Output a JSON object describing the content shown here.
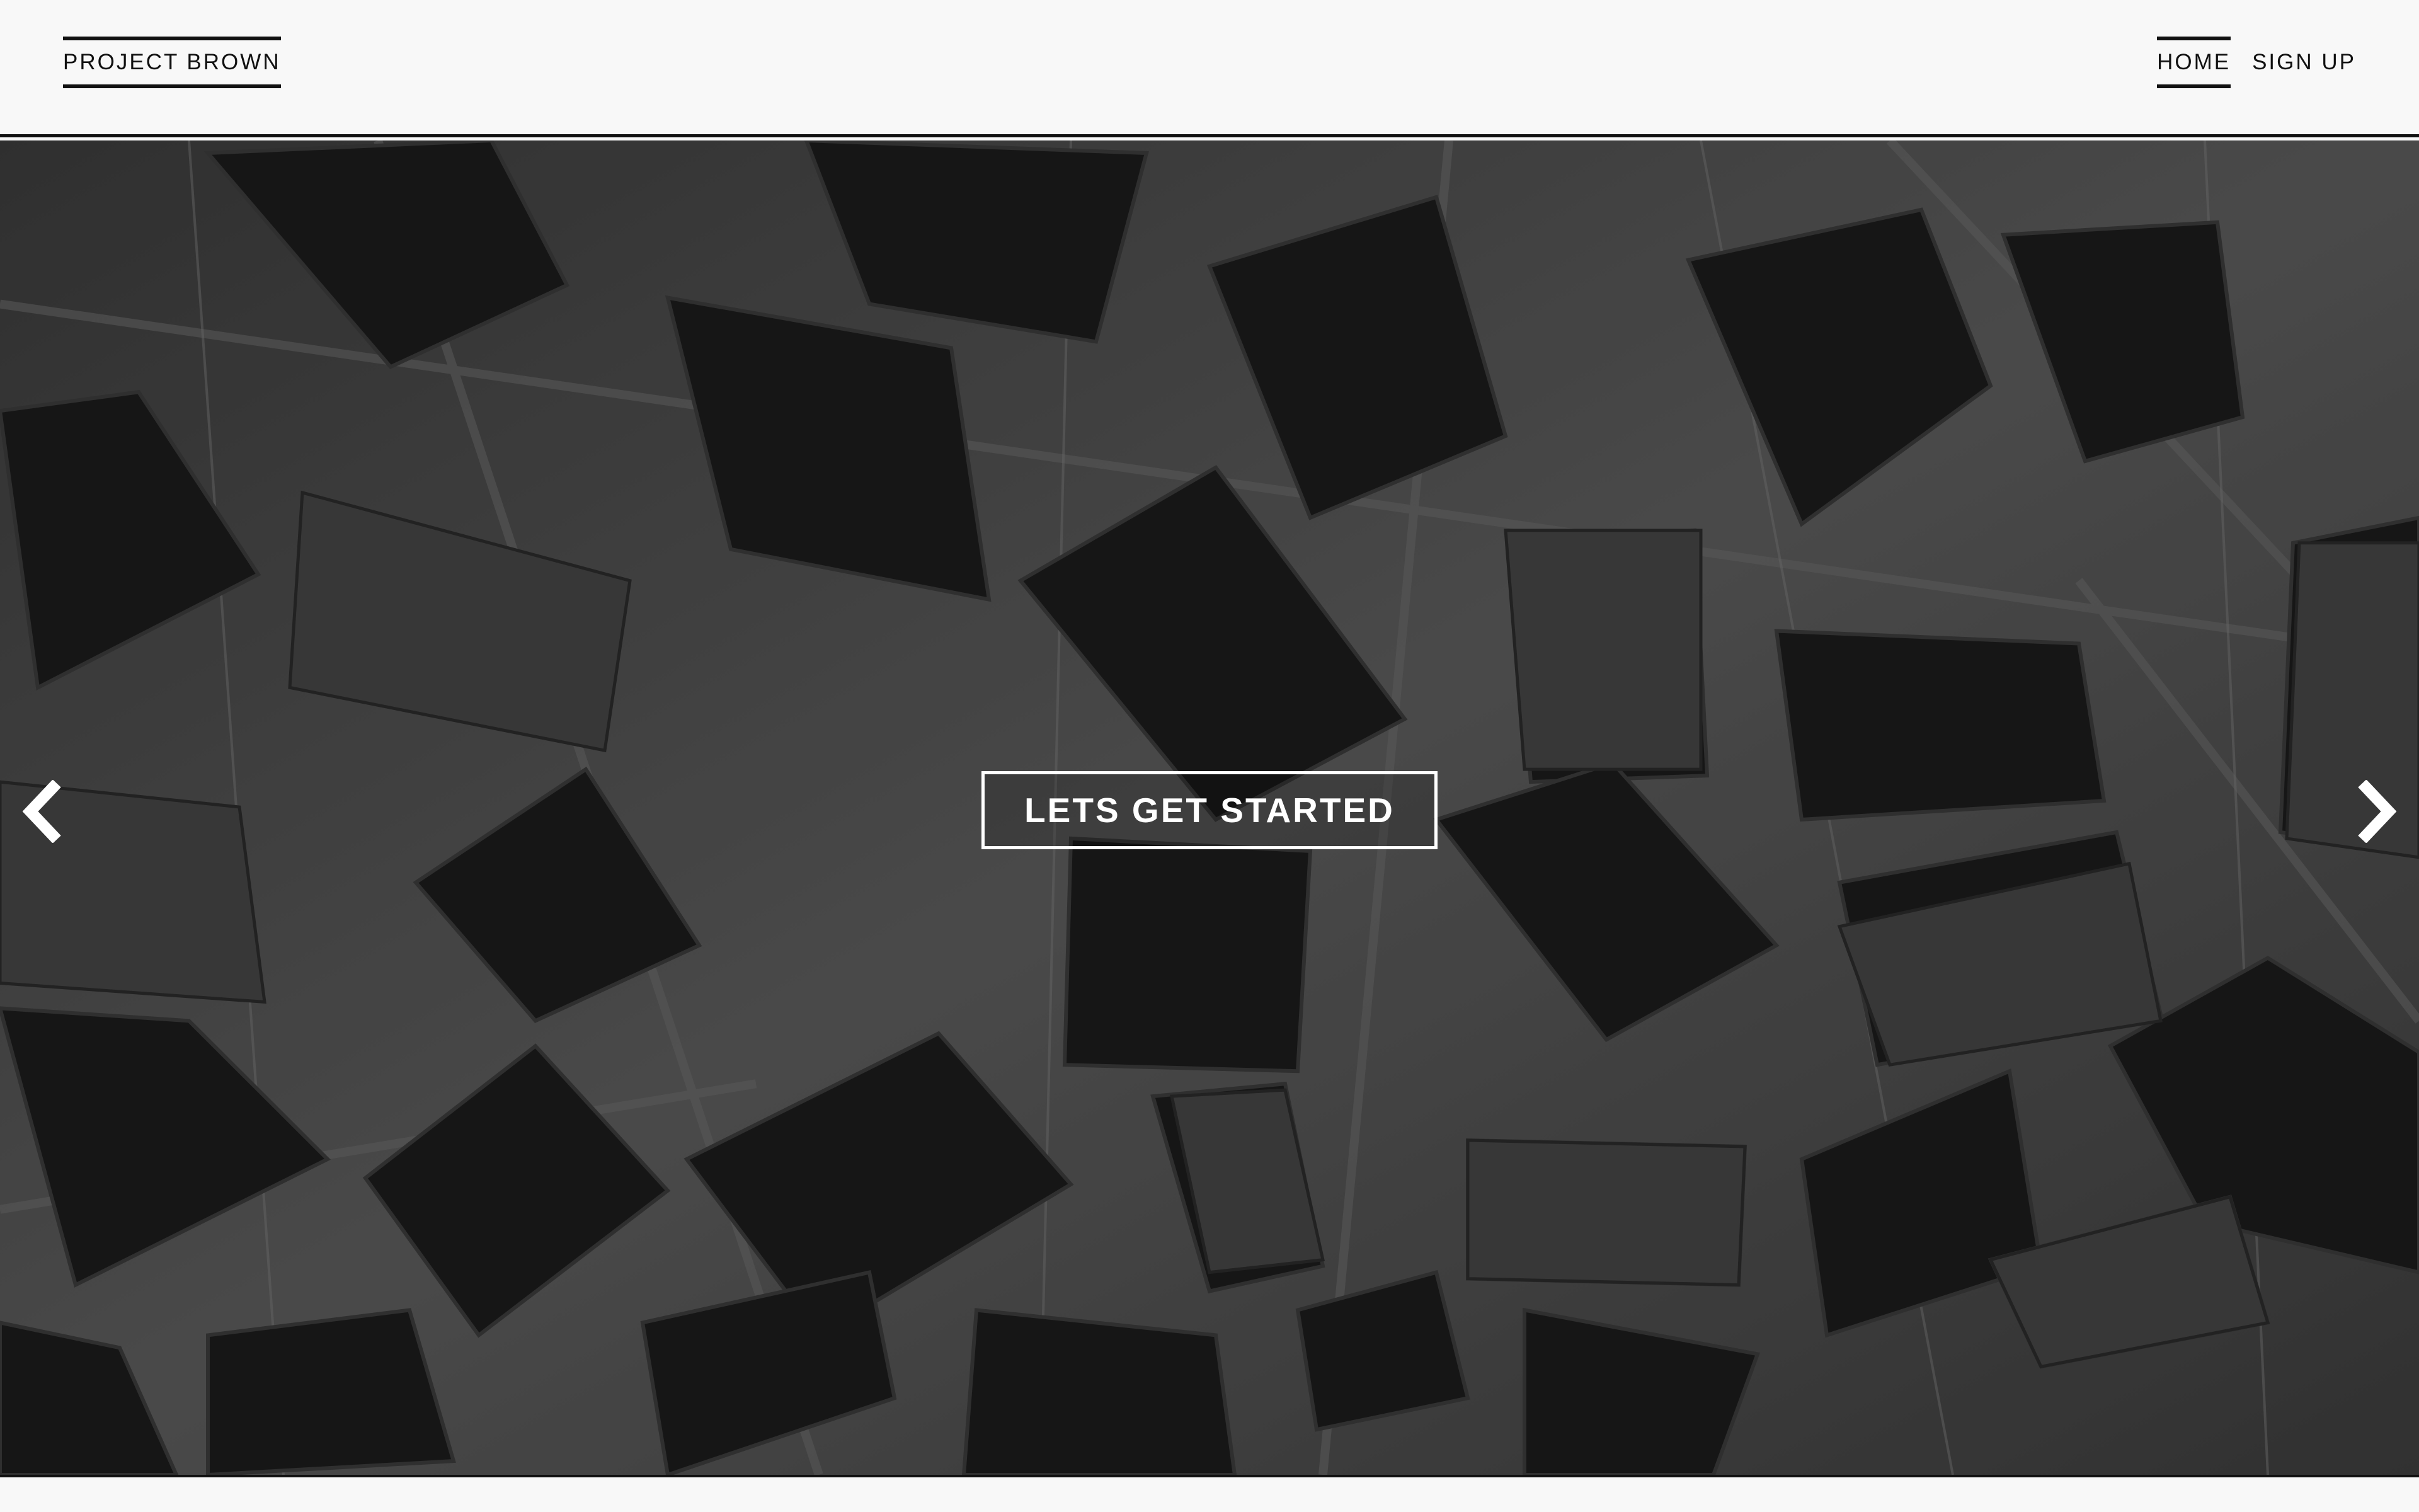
{
  "header": {
    "brand": "PROJECT BROWN",
    "nav": [
      {
        "label": "HOME",
        "active": true
      },
      {
        "label": "SIGN UP",
        "active": false
      }
    ]
  },
  "hero": {
    "cta_label": "LETS GET STARTED",
    "prev_icon": "chevron-left-icon",
    "next_icon": "chevron-right-icon"
  },
  "colors": {
    "header_bg": "#f8f8f8",
    "text": "#111111",
    "cta_text": "#ffffff"
  }
}
